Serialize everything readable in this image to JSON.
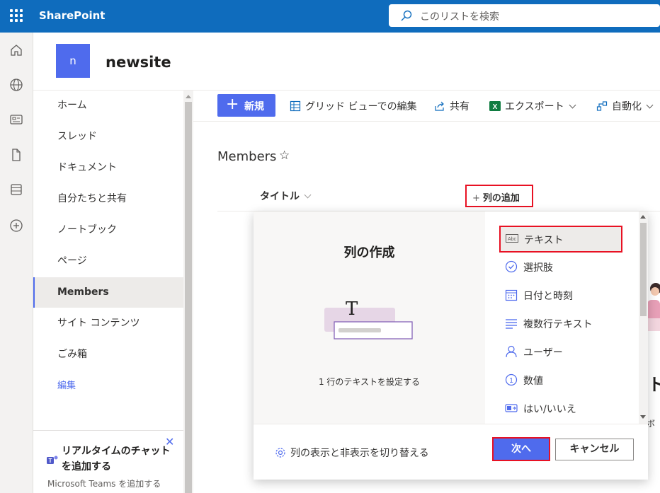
{
  "app": {
    "name": "SharePoint"
  },
  "search": {
    "placeholder": "このリストを検索"
  },
  "site": {
    "logo_letter": "n",
    "name": "newsite"
  },
  "nav": {
    "items": [
      {
        "label": "ホーム",
        "selected": false
      },
      {
        "label": "スレッド",
        "selected": false
      },
      {
        "label": "ドキュメント",
        "selected": false
      },
      {
        "label": "自分たちと共有",
        "selected": false
      },
      {
        "label": "ノートブック",
        "selected": false
      },
      {
        "label": "ページ",
        "selected": false
      },
      {
        "label": "Members",
        "selected": true
      },
      {
        "label": "サイト コンテンツ",
        "selected": false
      },
      {
        "label": "ごみ箱",
        "selected": false
      }
    ],
    "edit_link": "編集"
  },
  "promo": {
    "title": "リアルタイムのチャットを追加する",
    "subtitle": "Microsoft Teams を追加する"
  },
  "commands": {
    "new_label": "新規",
    "grid_edit": "グリッド ビューでの編集",
    "share": "共有",
    "export": "エクスポート",
    "automate": "自動化"
  },
  "list": {
    "title": "Members",
    "column_title": "タイトル",
    "add_column": "列の追加"
  },
  "create_column_panel": {
    "heading": "列の作成",
    "description": "1 行のテキストを設定する",
    "types": [
      {
        "label": "テキスト",
        "icon": "text-abc-icon",
        "selected": true
      },
      {
        "label": "選択肢",
        "icon": "choice-check-icon",
        "selected": false
      },
      {
        "label": "日付と時刻",
        "icon": "calendar-icon",
        "selected": false
      },
      {
        "label": "複数行テキスト",
        "icon": "multiline-text-icon",
        "selected": false
      },
      {
        "label": "ユーザー",
        "icon": "person-icon",
        "selected": false
      },
      {
        "label": "数値",
        "icon": "number-icon",
        "selected": false
      },
      {
        "label": "はい/いいえ",
        "icon": "yes-no-icon",
        "selected": false
      }
    ],
    "toggle_columns": "列の表示と非表示を切り替える",
    "next_label": "次へ",
    "cancel_label": "キャンセル"
  },
  "background_peek": {
    "big_text": "ト",
    "small_text": "ボタ"
  },
  "colors": {
    "suite_bar": "#0f6cbd",
    "accent": "#4f6bed",
    "highlight_border": "#e81123"
  }
}
